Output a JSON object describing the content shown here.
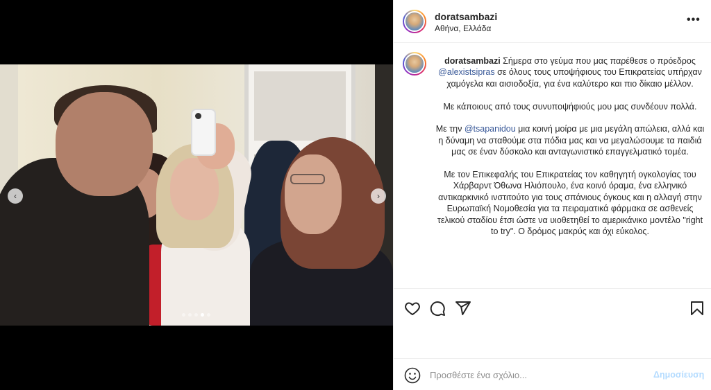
{
  "post": {
    "username": "doratsambazi",
    "location": "Αθήνα, Ελλάδα",
    "more_label": "•••"
  },
  "caption": {
    "username": "doratsambazi",
    "p1_a": " Σήμερα στο γεύμα που μας παρέθεσε ο πρόεδρος ",
    "p1_mention": "@alexistsipras",
    "p1_b": " σε όλους τους υποψήφιους του Επικρατείας υπήρχαν χαμόγελα και αισιοδοξία, για ένα καλύτερο και πιο δίκαιο μέλλον.",
    "p2": "Με κάποιους από τους συνυποψήφιούς μου μας συνδέουν πολλά.",
    "p3_a": "Με την ",
    "p3_mention": "@tsapanidou",
    "p3_b": " μια κοινή μοίρα με μια μεγάλη απώλεια, αλλά και η δύναμη να σταθούμε στα πόδια μας και να μεγαλώσουμε τα παιδιά μας σε έναν δύσκολο και ανταγωνιστικό επαγγελματικό τομέα.",
    "p4": "Με τον Επικεφαλής του Επικρατείας τον καθηγητή ογκολογίας του Χάρβαρντ Όθωνα Ηλιόπουλο, ένα κοινό όραμα, ένα ελληνικό αντικαρκινικό ινστιτούτο για τους σπάνιους όγκους και η αλλαγή στην Ευρωπαϊκή Νομοθεσία για τα πειραματικά φάρμακα σε ασθενείς τελικού σταδίου έτσι ώστε να υιοθετηθεί το αμερικάνικο μοντέλο \"right to try\". Ο δρόμος μακρύς και όχι εύκολος."
  },
  "carousel": {
    "prev_label": "‹",
    "next_label": "›",
    "slide_count": 5,
    "active_slide": 4
  },
  "comment": {
    "placeholder": "Προσθέστε ένα σχόλιο...",
    "post_label": "Δημοσίευση"
  },
  "colors": {
    "mention": "#385898",
    "post_button": "#b3dbff"
  }
}
